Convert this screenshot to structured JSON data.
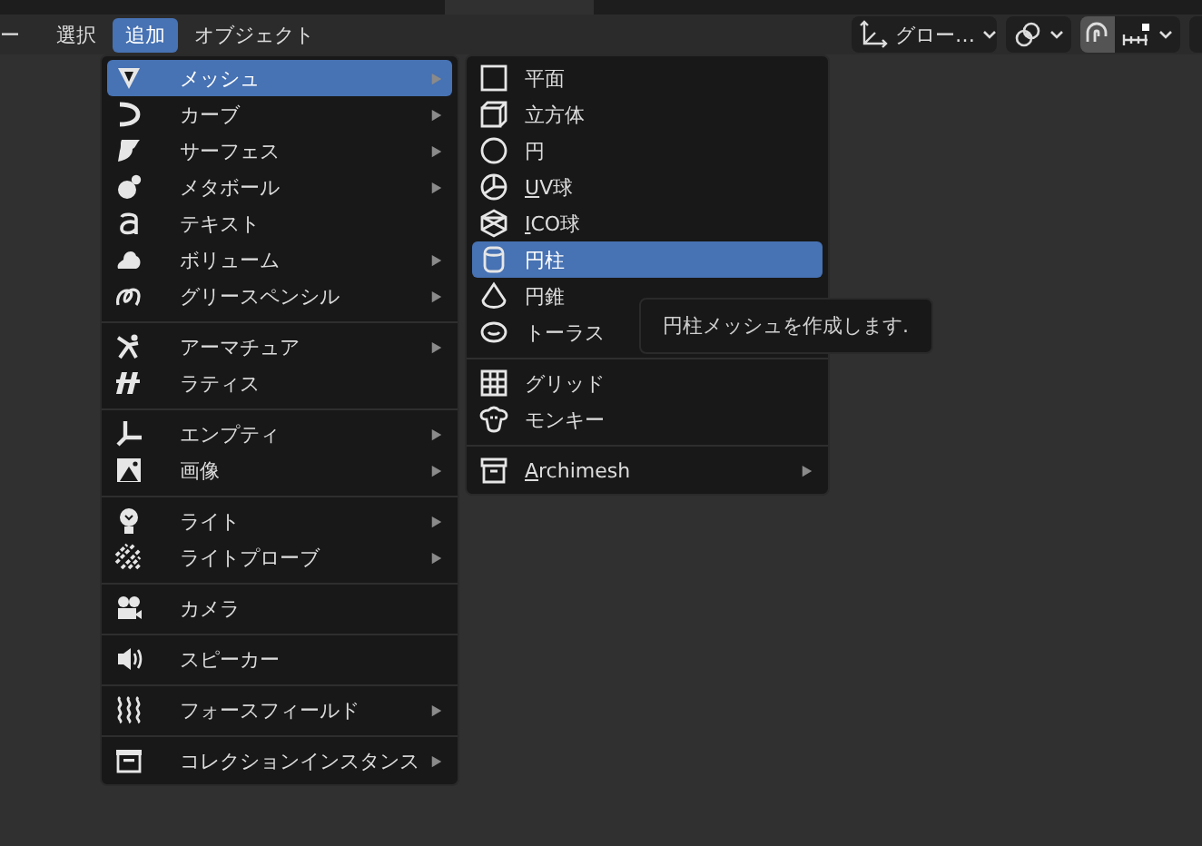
{
  "header": {
    "menus": [
      {
        "label": "ー",
        "selected": false
      },
      {
        "label": "選択",
        "selected": false
      },
      {
        "label": "追加",
        "selected": true
      },
      {
        "label": "オブジェクト",
        "selected": false
      }
    ],
    "orientation_dropdown": {
      "label": "グロー…"
    },
    "snap_toggle": {
      "on": true
    }
  },
  "add_menu": {
    "groups": [
      [
        {
          "label": "メッシュ",
          "submenu": true,
          "selected": true
        },
        {
          "label": "カーブ",
          "submenu": true,
          "selected": false
        },
        {
          "label": "サーフェス",
          "submenu": true,
          "selected": false
        },
        {
          "label": "メタボール",
          "submenu": true,
          "selected": false
        },
        {
          "label": "テキスト",
          "submenu": false,
          "selected": false
        },
        {
          "label": "ボリューム",
          "submenu": true,
          "selected": false
        },
        {
          "label": "グリースペンシル",
          "submenu": true,
          "selected": false
        }
      ],
      [
        {
          "label": "アーマチュア",
          "submenu": true,
          "selected": false
        },
        {
          "label": "ラティス",
          "submenu": false,
          "selected": false
        }
      ],
      [
        {
          "label": "エンプティ",
          "submenu": true,
          "selected": false
        },
        {
          "label": "画像",
          "submenu": true,
          "selected": false
        }
      ],
      [
        {
          "label": "ライト",
          "submenu": true,
          "selected": false
        },
        {
          "label": "ライトプローブ",
          "submenu": true,
          "selected": false
        }
      ],
      [
        {
          "label": "カメラ",
          "submenu": false,
          "selected": false
        }
      ],
      [
        {
          "label": "スピーカー",
          "submenu": false,
          "selected": false
        }
      ],
      [
        {
          "label": "フォースフィールド",
          "submenu": true,
          "selected": false
        }
      ],
      [
        {
          "label": "コレクションインスタンス",
          "submenu": true,
          "selected": false
        }
      ]
    ]
  },
  "mesh_submenu": {
    "groups": [
      [
        {
          "label": "平面",
          "selected": false
        },
        {
          "label": "立方体",
          "selected": false
        },
        {
          "label": "円",
          "selected": false
        },
        {
          "label": "UV球",
          "underline_first": true,
          "selected": false
        },
        {
          "label": "ICO球",
          "underline_first": true,
          "selected": false
        },
        {
          "label": "円柱",
          "selected": true
        },
        {
          "label": "円錐",
          "selected": false
        },
        {
          "label": "トーラス",
          "selected": false
        }
      ],
      [
        {
          "label": "グリッド",
          "selected": false
        },
        {
          "label": "モンキー",
          "selected": false
        }
      ],
      [
        {
          "label": "Archimesh",
          "submenu": true,
          "underline_first": true,
          "selected": false
        }
      ]
    ]
  },
  "tooltip": {
    "text": "円柱メッシュを作成します."
  }
}
